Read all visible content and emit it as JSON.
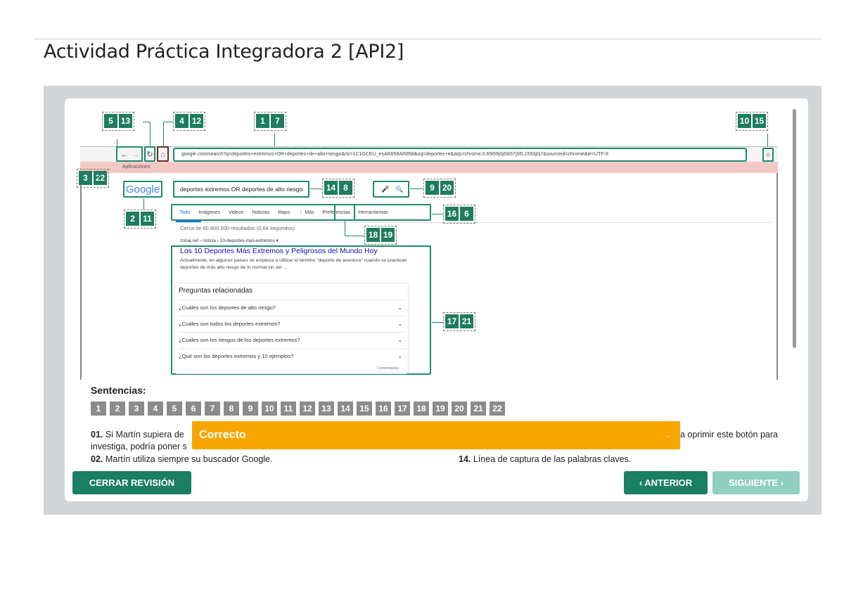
{
  "page": {
    "title": "Actividad Práctica Integradora 2 [API2]"
  },
  "browser": {
    "back": "←",
    "forward": "→",
    "reload": "↻",
    "home": "⌂",
    "url": "google.com/search?q=deportes+extremos+OR+deportes+de+alto+riesgo&rlz=1C1GCEU_esAR858AR858&oq=deportes+e&aqs=chrome.0.69i59j0j69i57j0l5.1593j0j7&sourceid=chrome&ie=UTF-8",
    "star": "☆",
    "apps_bar": "Aplicaciones"
  },
  "google": {
    "logo": "Google",
    "query": "deportes extremos OR deportes de alto riesgo",
    "mic": "🎤",
    "search": "🔍",
    "tabs": [
      "Todo",
      "Imágenes",
      "Videos",
      "Noticias",
      "Maps",
      "⋮ Más",
      "Preferencias",
      "Herramientas"
    ],
    "result_count": "Cerca de 60.800.000 resultados (0,64 segundos)",
    "cite": "zonaj.net › noticia › 10-deportes-mas-extremos ▾",
    "result_title": "Los 10 Deportes Más Extremos y Peligrosos del Mundo Hoy",
    "result_snippet": "Actualmente, en algunos países se empieza a utilizar el término \"deporte de aventura\" cuando se practican deportes de más alto riesgo de lo normal sin ser ...",
    "paa_title": "Preguntas relacionadas",
    "paa": [
      "¿Cuáles son los deportes de alto riesgo?",
      "¿Cuáles son todos los deportes extremos?",
      "¿Cuáles son los riesgos de los deportes extremos?",
      "¿Qué son los deportes extremos y 10 ejemplos?"
    ],
    "paa_chevron": "⌄",
    "comment": "Comentarios"
  },
  "badges": {
    "g1": [
      "5",
      "13"
    ],
    "g2": [
      "4",
      "12"
    ],
    "g3": [
      "1",
      "7"
    ],
    "g4": [
      "10",
      "15"
    ],
    "g5": [
      "3",
      "22"
    ],
    "g6": [
      "14",
      "8"
    ],
    "g7": [
      "9",
      "20"
    ],
    "g8": [
      "2",
      "11"
    ],
    "g9": [
      "16",
      "6"
    ],
    "g10": [
      "18",
      "19"
    ],
    "g11": [
      "17",
      "21"
    ]
  },
  "sentences": {
    "label": "Sentencias:",
    "chips": [
      "1",
      "2",
      "3",
      "4",
      "5",
      "6",
      "7",
      "8",
      "9",
      "10",
      "11",
      "12",
      "13",
      "14",
      "15",
      "16",
      "17",
      "18",
      "19",
      "20",
      "21",
      "22"
    ],
    "s01_num": "01.",
    "s01_text_a": "Si Martín supiera de",
    "s01_text_b": "investiga, podría poner s",
    "s02_num": "02.",
    "s02_text": "Martín utiliza siempre su buscador Google.",
    "right_a": "a oprimir este botón para",
    "s14_num": "14.",
    "s14_text": "Línea de captura de las palabras claves."
  },
  "toast": {
    "text": "Correcto",
    "chevron": "⌄"
  },
  "buttons": {
    "close": "CERRAR REVISIÓN",
    "prev": "‹ ANTERIOR",
    "next": "SIGUIENTE ›"
  },
  "colors": {
    "accent": "#1b7f63",
    "toast": "#f7a600",
    "disabled": "#8fd0c0",
    "chip": "#8c8c8c"
  }
}
